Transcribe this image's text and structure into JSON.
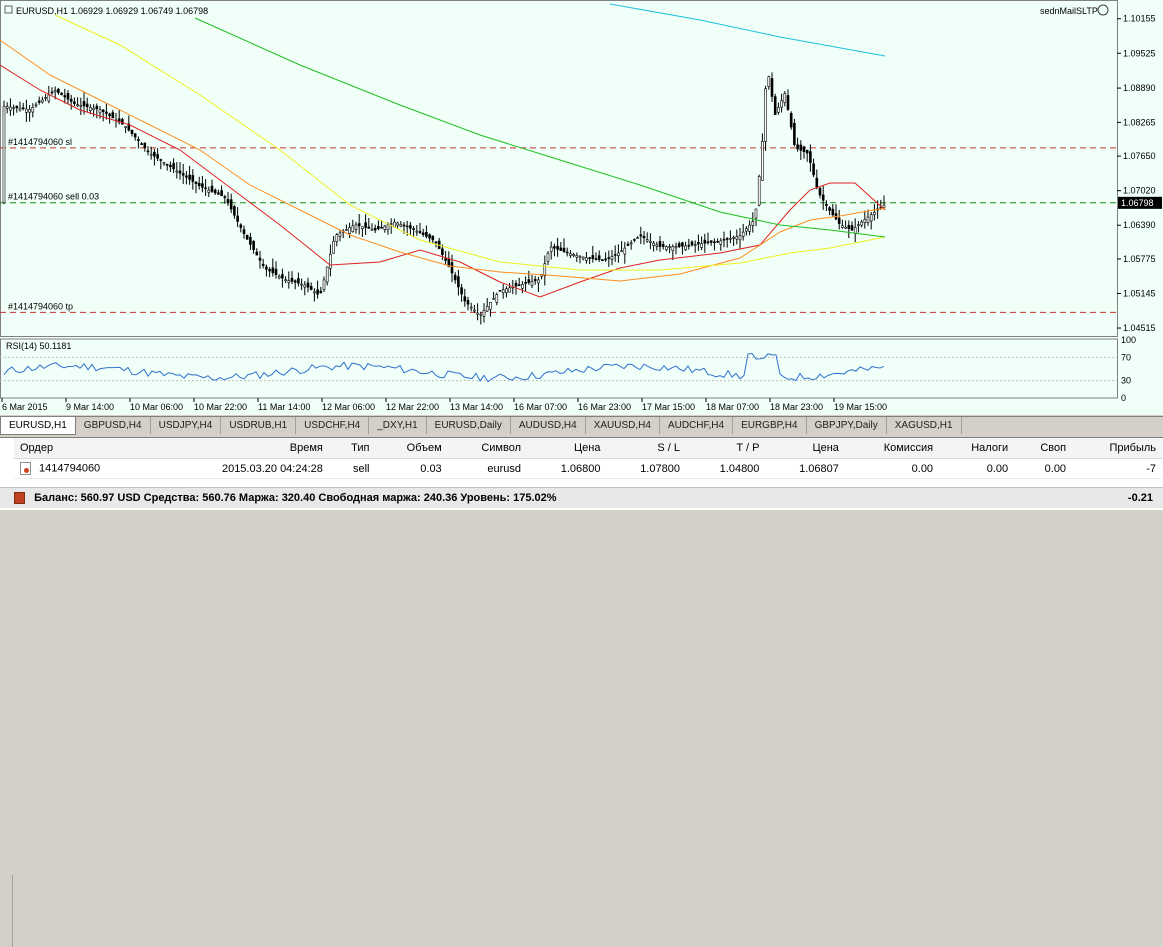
{
  "chart": {
    "header": "EURUSD,H1  1.06929 1.06929 1.06749 1.06798",
    "ea_name": "sednMailSLTP",
    "price_label": "1.06798",
    "lines": [
      {
        "label": "#1414794060 sl",
        "price": 1.078,
        "color": "#c83030"
      },
      {
        "label": "#1414794060 sell 0.03",
        "price": 1.068,
        "color": "#1a8a1a"
      },
      {
        "label": "#1414794060 tp",
        "price": 1.048,
        "color": "#c83030"
      }
    ],
    "price_ticks": [
      "1.10155",
      "1.09525",
      "1.08890",
      "1.08265",
      "1.07650",
      "1.07020",
      "1.06390",
      "1.05775",
      "1.05145",
      "1.04515"
    ],
    "time_ticks": [
      "6 Mar 2015",
      "9 Mar 14:00",
      "10 Mar 06:00",
      "10 Mar 22:00",
      "11 Mar 14:00",
      "12 Mar 06:00",
      "12 Mar 22:00",
      "13 Mar 14:00",
      "16 Mar 07:00",
      "16 Mar 23:00",
      "17 Mar 15:00",
      "18 Mar 07:00",
      "18 Mar 23:00",
      "19 Mar 15:00"
    ],
    "rsi_header": "RSI(14) 50.1181",
    "rsi_ticks": [
      "100",
      "70",
      "30",
      "0"
    ],
    "colors": {
      "bg": "#f0fff8",
      "ma_red": "#e02020",
      "ma_orange": "#ff8c20",
      "ma_yellow": "#f0f020",
      "ma_green": "#20c020",
      "ma_cyan": "#20c0e0",
      "rsi": "#3070d0"
    }
  },
  "tabs": [
    "EURUSD,H1",
    "GBPUSD,H4",
    "USDJPY,H4",
    "USDRUB,H1",
    "USDCHF,H4",
    "_DXY,H1",
    "EURUSD,Daily",
    "AUDUSD,H4",
    "XAUUSD,H4",
    "AUDCHF,H4",
    "EURGBP,H4",
    "GBPJPY,Daily",
    "XAGUSD,H1"
  ],
  "terminal": {
    "columns": [
      "Ордер",
      "Время",
      "Тип",
      "Объем",
      "Символ",
      "Цена",
      "S / L",
      "T / P",
      "Цена",
      "Комиссия",
      "Налоги",
      "Своп",
      "Прибыль"
    ],
    "rows": [
      [
        "1414794060",
        "2015.03.20 04:24:28",
        "sell",
        "0.03",
        "eurusd",
        "1.06800",
        "1.07800",
        "1.04800",
        "1.06807",
        "0.00",
        "0.00",
        "0.00",
        "-7"
      ]
    ],
    "balance_text": "Баланс: 560.97 USD  Средства: 560.76  Маржа: 320.40  Свободная маржа: 240.36  Уровень: 175.02%",
    "balance_profit": "-0.21"
  }
}
